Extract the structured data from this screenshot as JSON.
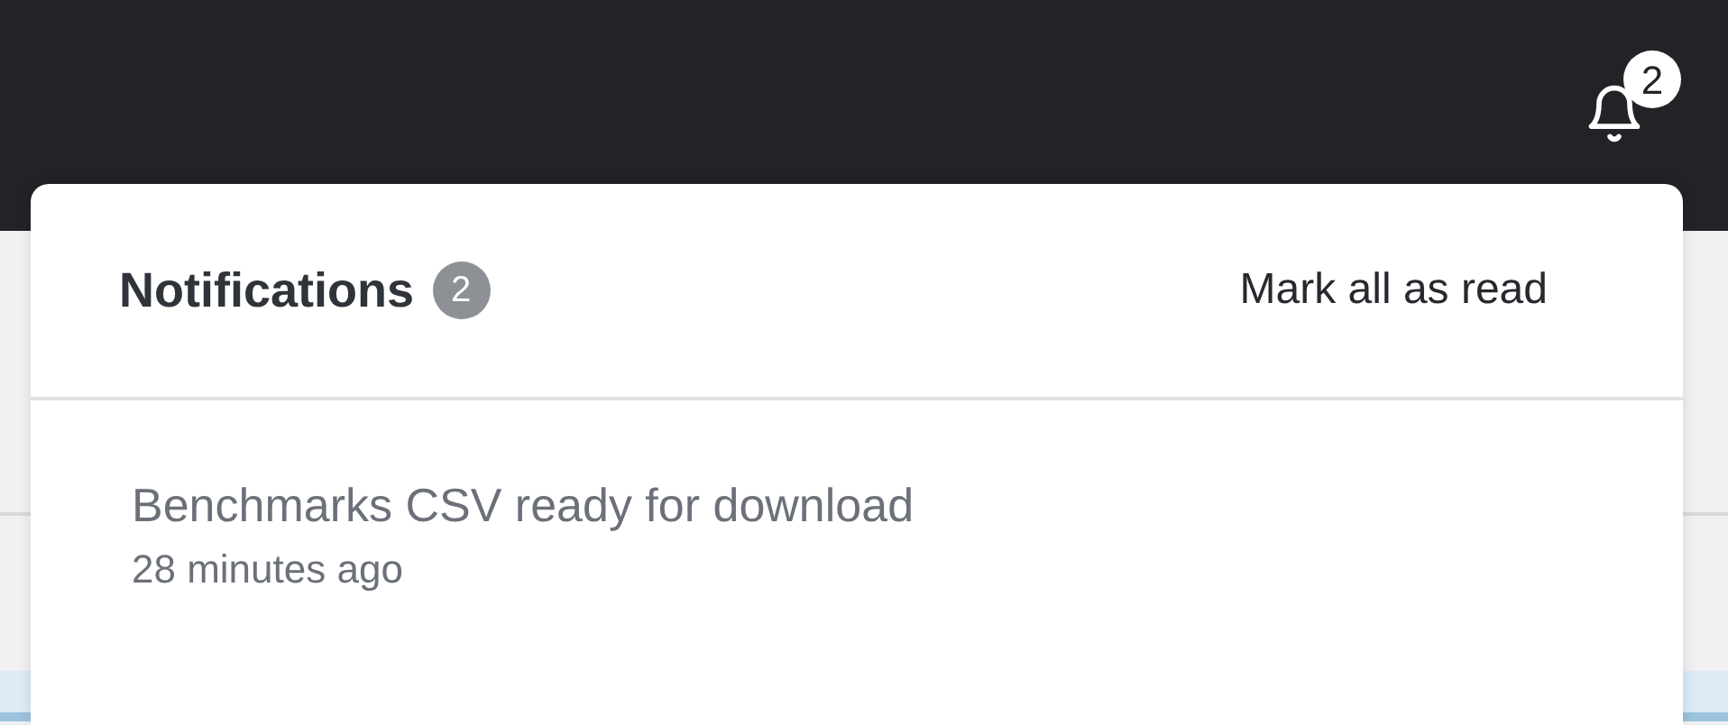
{
  "top_bar": {
    "bell_badge": "2"
  },
  "notifications_panel": {
    "title": "Notifications",
    "count": "2",
    "mark_all_read": "Mark all as read",
    "items": [
      {
        "title": "Benchmarks CSV ready for download",
        "time": "28 minutes ago"
      }
    ]
  }
}
